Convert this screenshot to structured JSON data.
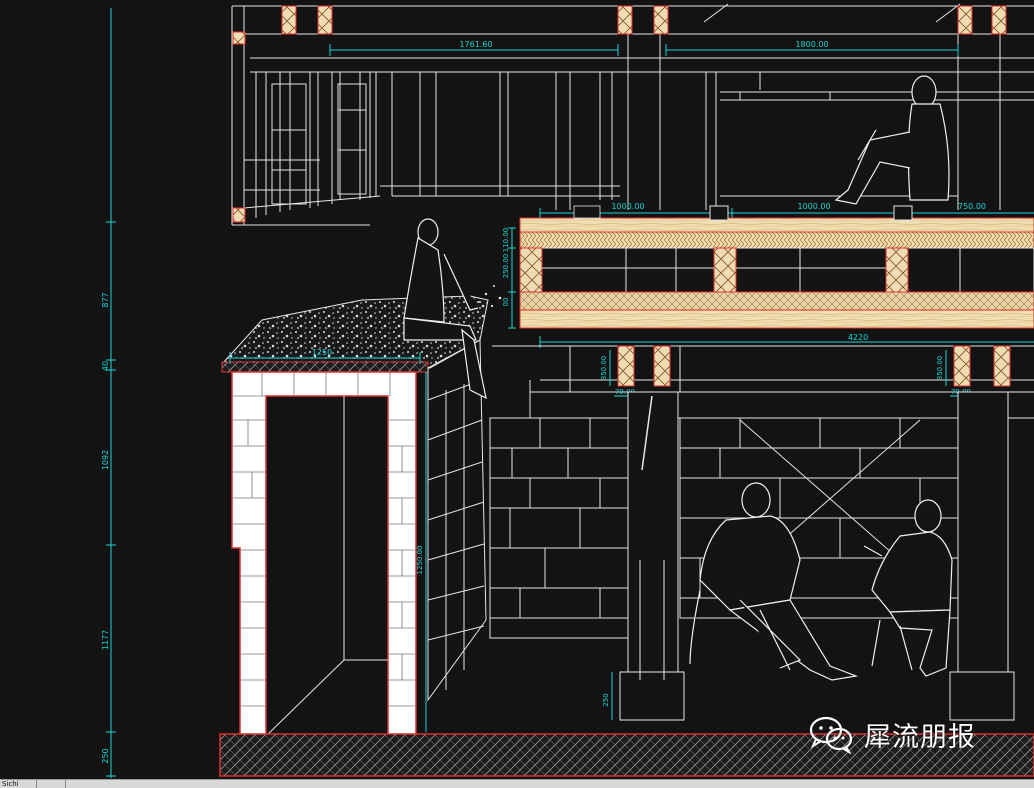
{
  "dimensions": {
    "top_left": "1761.60",
    "top_right": "1800.00",
    "deck_left": "1000.00",
    "deck_mid": "1000.00",
    "deck_right": "750.00",
    "beam_span": "4220",
    "post_height_left": "350.00",
    "post_height_right": "350.00",
    "post_width_left": "70.00",
    "post_width_right": "70.00",
    "deck_stack_a": "250.00",
    "deck_stack_b": "110.00",
    "deck_stack_c": "00",
    "bench_width": "1250",
    "bench_height": "1250.00",
    "left_vertical_1": "877",
    "left_vertical_2": "40",
    "left_vertical_3": "1092",
    "left_vertical_4": "1177",
    "left_vertical_5": "250",
    "footing_height": "250"
  },
  "watermark": {
    "icon": "wechat-icon",
    "text": "犀流朋报"
  },
  "status_bar": {
    "tab_label": "Sichi"
  },
  "colors": {
    "background": "#131313",
    "line": "#e8e8e8",
    "dimension": "#18d6d6",
    "section_cut": "#e03030",
    "timber_light": "#f1dfb2",
    "timber_mid": "#e0c28a"
  }
}
